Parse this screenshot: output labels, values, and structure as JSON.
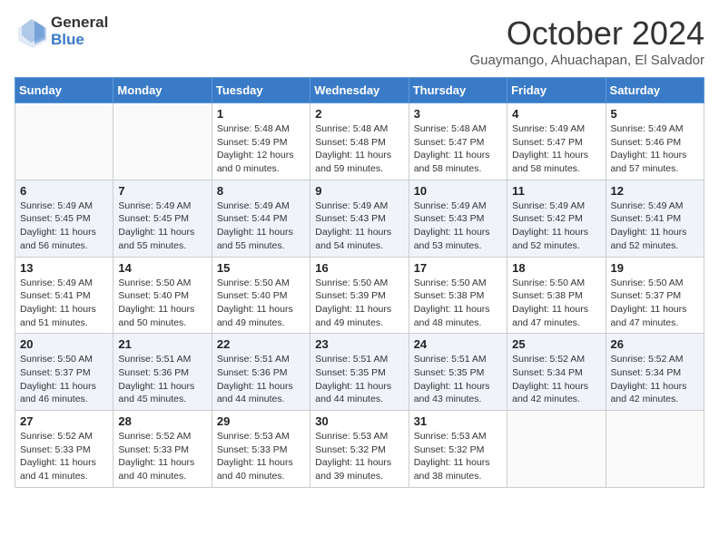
{
  "header": {
    "logo_line1": "General",
    "logo_line2": "Blue",
    "month_title": "October 2024",
    "location": "Guaymango, Ahuachapan, El Salvador"
  },
  "weekdays": [
    "Sunday",
    "Monday",
    "Tuesday",
    "Wednesday",
    "Thursday",
    "Friday",
    "Saturday"
  ],
  "weeks": [
    [
      {
        "day": "",
        "lines": []
      },
      {
        "day": "",
        "lines": []
      },
      {
        "day": "1",
        "lines": [
          "Sunrise: 5:48 AM",
          "Sunset: 5:49 PM",
          "Daylight: 12 hours",
          "and 0 minutes."
        ]
      },
      {
        "day": "2",
        "lines": [
          "Sunrise: 5:48 AM",
          "Sunset: 5:48 PM",
          "Daylight: 11 hours",
          "and 59 minutes."
        ]
      },
      {
        "day": "3",
        "lines": [
          "Sunrise: 5:48 AM",
          "Sunset: 5:47 PM",
          "Daylight: 11 hours",
          "and 58 minutes."
        ]
      },
      {
        "day": "4",
        "lines": [
          "Sunrise: 5:49 AM",
          "Sunset: 5:47 PM",
          "Daylight: 11 hours",
          "and 58 minutes."
        ]
      },
      {
        "day": "5",
        "lines": [
          "Sunrise: 5:49 AM",
          "Sunset: 5:46 PM",
          "Daylight: 11 hours",
          "and 57 minutes."
        ]
      }
    ],
    [
      {
        "day": "6",
        "lines": [
          "Sunrise: 5:49 AM",
          "Sunset: 5:45 PM",
          "Daylight: 11 hours",
          "and 56 minutes."
        ]
      },
      {
        "day": "7",
        "lines": [
          "Sunrise: 5:49 AM",
          "Sunset: 5:45 PM",
          "Daylight: 11 hours",
          "and 55 minutes."
        ]
      },
      {
        "day": "8",
        "lines": [
          "Sunrise: 5:49 AM",
          "Sunset: 5:44 PM",
          "Daylight: 11 hours",
          "and 55 minutes."
        ]
      },
      {
        "day": "9",
        "lines": [
          "Sunrise: 5:49 AM",
          "Sunset: 5:43 PM",
          "Daylight: 11 hours",
          "and 54 minutes."
        ]
      },
      {
        "day": "10",
        "lines": [
          "Sunrise: 5:49 AM",
          "Sunset: 5:43 PM",
          "Daylight: 11 hours",
          "and 53 minutes."
        ]
      },
      {
        "day": "11",
        "lines": [
          "Sunrise: 5:49 AM",
          "Sunset: 5:42 PM",
          "Daylight: 11 hours",
          "and 52 minutes."
        ]
      },
      {
        "day": "12",
        "lines": [
          "Sunrise: 5:49 AM",
          "Sunset: 5:41 PM",
          "Daylight: 11 hours",
          "and 52 minutes."
        ]
      }
    ],
    [
      {
        "day": "13",
        "lines": [
          "Sunrise: 5:49 AM",
          "Sunset: 5:41 PM",
          "Daylight: 11 hours",
          "and 51 minutes."
        ]
      },
      {
        "day": "14",
        "lines": [
          "Sunrise: 5:50 AM",
          "Sunset: 5:40 PM",
          "Daylight: 11 hours",
          "and 50 minutes."
        ]
      },
      {
        "day": "15",
        "lines": [
          "Sunrise: 5:50 AM",
          "Sunset: 5:40 PM",
          "Daylight: 11 hours",
          "and 49 minutes."
        ]
      },
      {
        "day": "16",
        "lines": [
          "Sunrise: 5:50 AM",
          "Sunset: 5:39 PM",
          "Daylight: 11 hours",
          "and 49 minutes."
        ]
      },
      {
        "day": "17",
        "lines": [
          "Sunrise: 5:50 AM",
          "Sunset: 5:38 PM",
          "Daylight: 11 hours",
          "and 48 minutes."
        ]
      },
      {
        "day": "18",
        "lines": [
          "Sunrise: 5:50 AM",
          "Sunset: 5:38 PM",
          "Daylight: 11 hours",
          "and 47 minutes."
        ]
      },
      {
        "day": "19",
        "lines": [
          "Sunrise: 5:50 AM",
          "Sunset: 5:37 PM",
          "Daylight: 11 hours",
          "and 47 minutes."
        ]
      }
    ],
    [
      {
        "day": "20",
        "lines": [
          "Sunrise: 5:50 AM",
          "Sunset: 5:37 PM",
          "Daylight: 11 hours",
          "and 46 minutes."
        ]
      },
      {
        "day": "21",
        "lines": [
          "Sunrise: 5:51 AM",
          "Sunset: 5:36 PM",
          "Daylight: 11 hours",
          "and 45 minutes."
        ]
      },
      {
        "day": "22",
        "lines": [
          "Sunrise: 5:51 AM",
          "Sunset: 5:36 PM",
          "Daylight: 11 hours",
          "and 44 minutes."
        ]
      },
      {
        "day": "23",
        "lines": [
          "Sunrise: 5:51 AM",
          "Sunset: 5:35 PM",
          "Daylight: 11 hours",
          "and 44 minutes."
        ]
      },
      {
        "day": "24",
        "lines": [
          "Sunrise: 5:51 AM",
          "Sunset: 5:35 PM",
          "Daylight: 11 hours",
          "and 43 minutes."
        ]
      },
      {
        "day": "25",
        "lines": [
          "Sunrise: 5:52 AM",
          "Sunset: 5:34 PM",
          "Daylight: 11 hours",
          "and 42 minutes."
        ]
      },
      {
        "day": "26",
        "lines": [
          "Sunrise: 5:52 AM",
          "Sunset: 5:34 PM",
          "Daylight: 11 hours",
          "and 42 minutes."
        ]
      }
    ],
    [
      {
        "day": "27",
        "lines": [
          "Sunrise: 5:52 AM",
          "Sunset: 5:33 PM",
          "Daylight: 11 hours",
          "and 41 minutes."
        ]
      },
      {
        "day": "28",
        "lines": [
          "Sunrise: 5:52 AM",
          "Sunset: 5:33 PM",
          "Daylight: 11 hours",
          "and 40 minutes."
        ]
      },
      {
        "day": "29",
        "lines": [
          "Sunrise: 5:53 AM",
          "Sunset: 5:33 PM",
          "Daylight: 11 hours",
          "and 40 minutes."
        ]
      },
      {
        "day": "30",
        "lines": [
          "Sunrise: 5:53 AM",
          "Sunset: 5:32 PM",
          "Daylight: 11 hours",
          "and 39 minutes."
        ]
      },
      {
        "day": "31",
        "lines": [
          "Sunrise: 5:53 AM",
          "Sunset: 5:32 PM",
          "Daylight: 11 hours",
          "and 38 minutes."
        ]
      },
      {
        "day": "",
        "lines": []
      },
      {
        "day": "",
        "lines": []
      }
    ]
  ]
}
